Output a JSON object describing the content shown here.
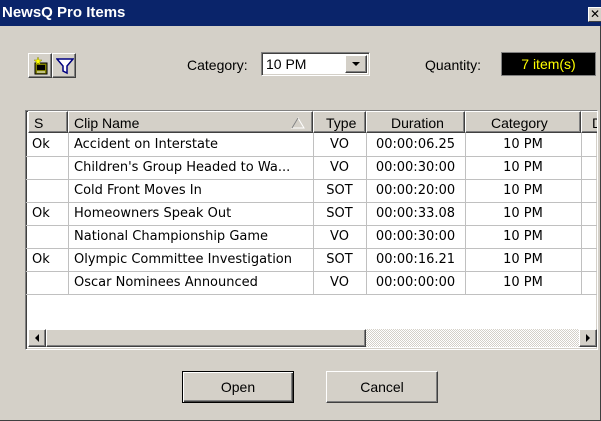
{
  "window": {
    "title": "NewsQ Pro Items",
    "close_glyph": "✕"
  },
  "toolbar": {
    "new_icon": "new-item-icon",
    "filter_icon": "filter-icon"
  },
  "category": {
    "label": "Category:",
    "value": "10 PM"
  },
  "quantity": {
    "label": "Quantity:",
    "value": "7 item(s)",
    "value_color": "#ffff00"
  },
  "table": {
    "columns": [
      "S",
      "Clip Name",
      "Type",
      "Duration",
      "Category",
      "D"
    ],
    "sort_column": "Clip Name",
    "rows": [
      {
        "s": "Ok",
        "clip_name": "Accident on Interstate",
        "type": "VO",
        "duration": "00:00:06.25",
        "category": "10 PM"
      },
      {
        "s": "",
        "clip_name": "Children's Group Headed to Wa...",
        "type": "VO",
        "duration": "00:00:30:00",
        "category": "10 PM"
      },
      {
        "s": "",
        "clip_name": "Cold Front Moves In",
        "type": "SOT",
        "duration": "00:00:20:00",
        "category": "10 PM"
      },
      {
        "s": "Ok",
        "clip_name": "Homeowners Speak Out",
        "type": "SOT",
        "duration": "00:00:33.08",
        "category": "10 PM"
      },
      {
        "s": "",
        "clip_name": "National Championship Game",
        "type": "VO",
        "duration": "00:00:30:00",
        "category": "10 PM"
      },
      {
        "s": "Ok",
        "clip_name": "Olympic Committee Investigation",
        "type": "SOT",
        "duration": "00:00:16.21",
        "category": "10 PM"
      },
      {
        "s": "",
        "clip_name": "Oscar Nominees Announced",
        "type": "VO",
        "duration": "00:00:00:00",
        "category": "10 PM"
      }
    ]
  },
  "buttons": {
    "open": "Open",
    "cancel": "Cancel"
  },
  "colors": {
    "titlebar": "#0a246a",
    "face": "#d4d0c8"
  }
}
